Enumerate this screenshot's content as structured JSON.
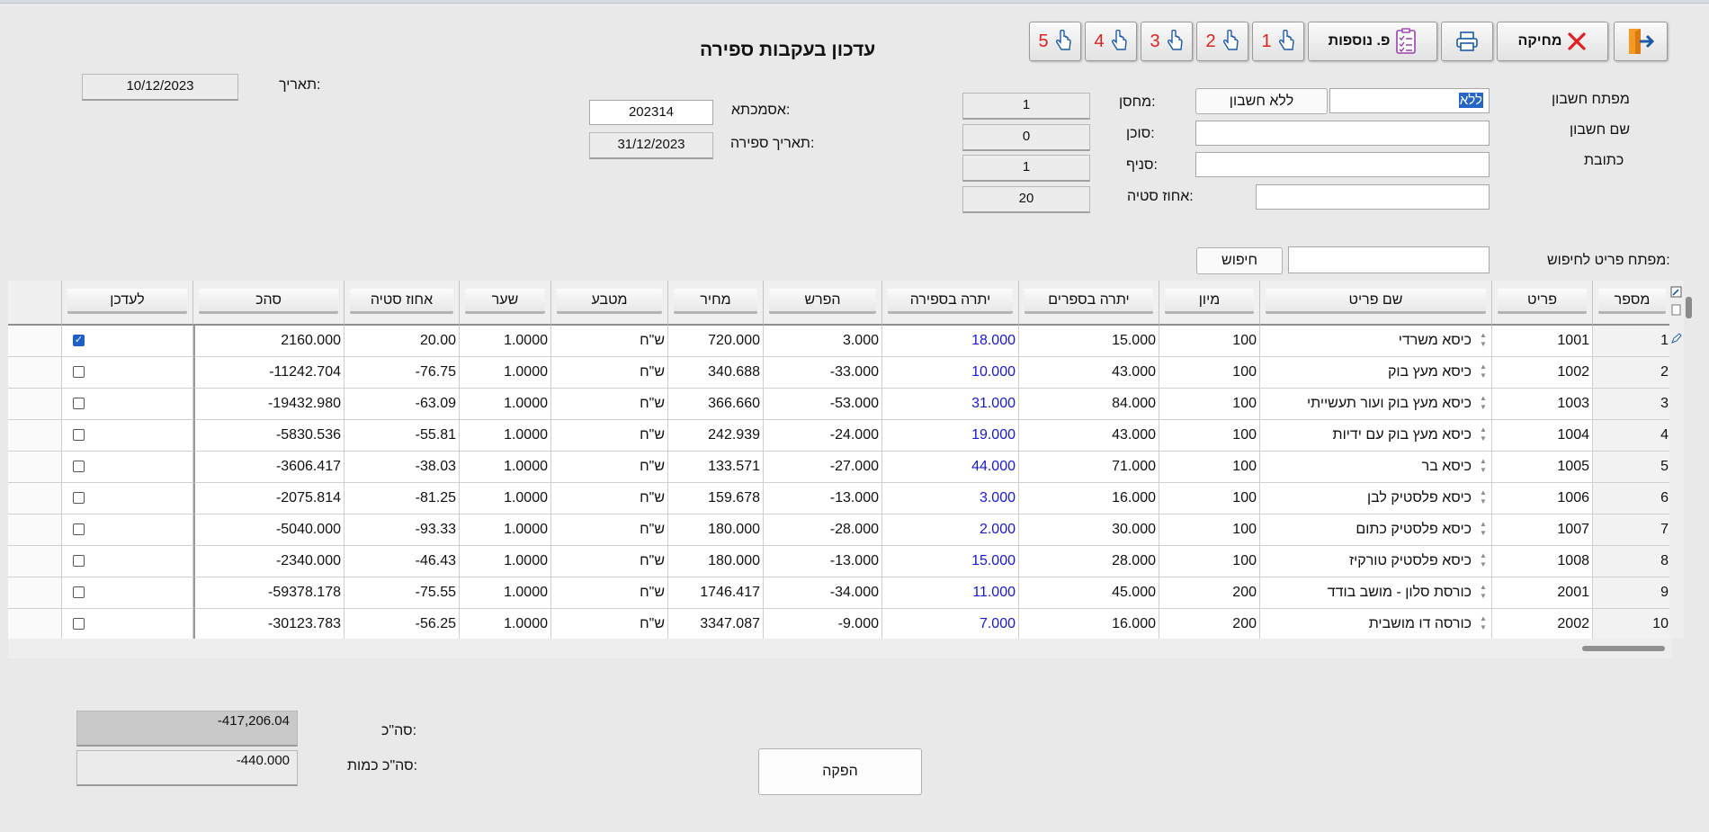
{
  "header": {
    "title": "עדכון בעקבות ספירה",
    "date_label": "תאריך:",
    "date_value": "10/12/2023"
  },
  "toolbar": {
    "delete_label": "מחיקה",
    "more_label": "פ. נוספות",
    "quick_buttons": [
      "5",
      "4",
      "3",
      "2",
      "1"
    ],
    "colors": {
      "delete_x": "#e02020",
      "exit_icon": "#f59a23",
      "hand_number": "#d22222"
    }
  },
  "form": {
    "account_key_label": "מפתח חשבון",
    "account_key_value": "ללא",
    "no_account_button": "ללא חשבון",
    "account_name_label": "שם חשבון",
    "account_name_value": "",
    "address_label": "כתובת",
    "address_value": "",
    "warehouse_label": "מחסן:",
    "warehouse_value": "1",
    "agent_label": "סוכן:",
    "agent_value": "0",
    "branch_label": "סניף:",
    "branch_value": "1",
    "deviation_label": "אחוז סטיה:",
    "deviation_value": "20",
    "extra_field_value": "",
    "reference_label": "אסמכתא:",
    "reference_value": "202314",
    "count_date_label": "תאריך ספירה:",
    "count_date_value": "31/12/2023",
    "search_label": "מפתח פריט לחיפוש:",
    "search_value": "",
    "search_button": "חיפוש"
  },
  "table": {
    "headers": {
      "num": "מספר",
      "item": "פריט",
      "name": "שם פריט",
      "sort": "מיון",
      "bal_books": "יתרה בספרים",
      "bal_count": "יתרה בספירה",
      "diff": "הפרש",
      "price": "מחיר",
      "currency": "מטבע",
      "rate": "שער",
      "dev": "אחוז סטיה",
      "total": "סהכ",
      "update": "לעדכן"
    },
    "rows": [
      {
        "num": "1",
        "item": "1001",
        "name": "כיסא משרדי",
        "sort": "100",
        "bal_books": "15.000",
        "bal_count": "18.000",
        "diff": "3.000",
        "price": "720.000",
        "currency": "ש\"ח",
        "rate": "1.0000",
        "dev": "20.00",
        "total": "2160.000",
        "update": true
      },
      {
        "num": "2",
        "item": "1002",
        "name": "כיסא מעץ בוק",
        "sort": "100",
        "bal_books": "43.000",
        "bal_count": "10.000",
        "diff": "-33.000",
        "price": "340.688",
        "currency": "ש\"ח",
        "rate": "1.0000",
        "dev": "-76.75",
        "total": "-11242.704",
        "update": false
      },
      {
        "num": "3",
        "item": "1003",
        "name": "כיסא מעץ בוק ועור תעשייתי",
        "sort": "100",
        "bal_books": "84.000",
        "bal_count": "31.000",
        "diff": "-53.000",
        "price": "366.660",
        "currency": "ש\"ח",
        "rate": "1.0000",
        "dev": "-63.09",
        "total": "-19432.980",
        "update": false
      },
      {
        "num": "4",
        "item": "1004",
        "name": "כיסא מעץ בוק עם ידיות",
        "sort": "100",
        "bal_books": "43.000",
        "bal_count": "19.000",
        "diff": "-24.000",
        "price": "242.939",
        "currency": "ש\"ח",
        "rate": "1.0000",
        "dev": "-55.81",
        "total": "-5830.536",
        "update": false
      },
      {
        "num": "5",
        "item": "1005",
        "name": "כיסא בר",
        "sort": "100",
        "bal_books": "71.000",
        "bal_count": "44.000",
        "diff": "-27.000",
        "price": "133.571",
        "currency": "ש\"ח",
        "rate": "1.0000",
        "dev": "-38.03",
        "total": "-3606.417",
        "update": false
      },
      {
        "num": "6",
        "item": "1006",
        "name": "כיסא פלסטיק לבן",
        "sort": "100",
        "bal_books": "16.000",
        "bal_count": "3.000",
        "diff": "-13.000",
        "price": "159.678",
        "currency": "ש\"ח",
        "rate": "1.0000",
        "dev": "-81.25",
        "total": "-2075.814",
        "update": false
      },
      {
        "num": "7",
        "item": "1007",
        "name": "כיסא פלסטיק כתום",
        "sort": "100",
        "bal_books": "30.000",
        "bal_count": "2.000",
        "diff": "-28.000",
        "price": "180.000",
        "currency": "ש\"ח",
        "rate": "1.0000",
        "dev": "-93.33",
        "total": "-5040.000",
        "update": false
      },
      {
        "num": "8",
        "item": "1008",
        "name": "כיסא פלסטיק טורקיז",
        "sort": "100",
        "bal_books": "28.000",
        "bal_count": "15.000",
        "diff": "-13.000",
        "price": "180.000",
        "currency": "ש\"ח",
        "rate": "1.0000",
        "dev": "-46.43",
        "total": "-2340.000",
        "update": false
      },
      {
        "num": "9",
        "item": "2001",
        "name": "כורסת סלון - מושב בודד",
        "sort": "200",
        "bal_books": "45.000",
        "bal_count": "11.000",
        "diff": "-34.000",
        "price": "1746.417",
        "currency": "ש\"ח",
        "rate": "1.0000",
        "dev": "-75.55",
        "total": "-59378.178",
        "update": false
      },
      {
        "num": "10",
        "item": "2002",
        "name": "כורסה דו מושבית",
        "sort": "200",
        "bal_books": "16.000",
        "bal_count": "7.000",
        "diff": "-9.000",
        "price": "3347.087",
        "currency": "ש\"ח",
        "rate": "1.0000",
        "dev": "-56.25",
        "total": "-30123.783",
        "update": false
      }
    ]
  },
  "summary": {
    "total_label": "סה\"כ:",
    "total_value": "-417,206.04",
    "qty_label": "סה\"כ כמות:",
    "qty_value": "-440.000"
  },
  "footer": {
    "produce_button": "הפקה"
  }
}
